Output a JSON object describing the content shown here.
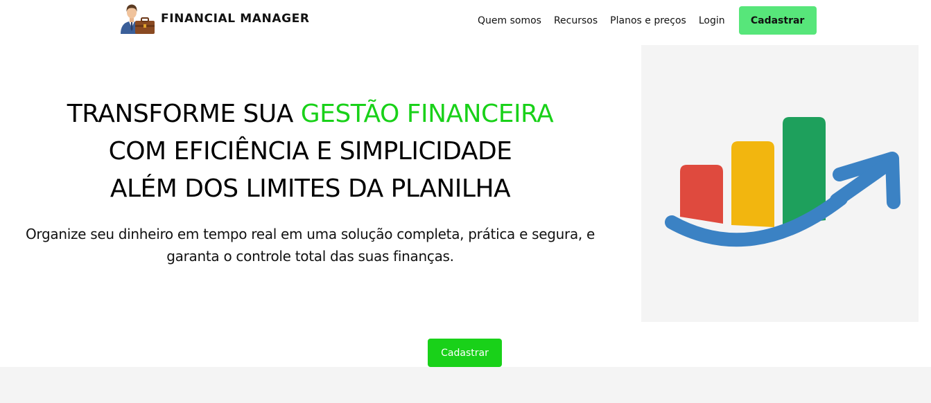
{
  "header": {
    "brand": "FINANCIAL MANAGER",
    "logo_icon": "businessman-briefcase-icon",
    "nav": [
      {
        "label": "Quem somos"
      },
      {
        "label": "Recursos"
      },
      {
        "label": "Planos e preços"
      },
      {
        "label": "Login"
      }
    ],
    "cta_label": "Cadastrar"
  },
  "hero": {
    "title_line1_prefix": "TRANSFORME SUA ",
    "title_line1_accent": "GESTÃO FINANCEIRA",
    "title_line2": "COM EFICIÊNCIA E SIMPLICIDADE",
    "title_line3": "ALÉM DOS LIMITES DA PLANILHA",
    "subtitle": "Organize seu dinheiro em tempo real em uma solução completa, prática e segura, e garanta o controle total das suas finanças.",
    "image_icon": "growth-bar-chart-arrow-icon",
    "cta_label": "Cadastrar"
  },
  "colors": {
    "accent_green": "#19d119",
    "nav_cta_green": "#57e67a",
    "panel_gray": "#f4f4f4",
    "bar_red": "#df4a3e",
    "bar_yellow": "#f2b60f",
    "bar_green": "#1ea05c",
    "arrow_blue": "#3b82c4"
  }
}
